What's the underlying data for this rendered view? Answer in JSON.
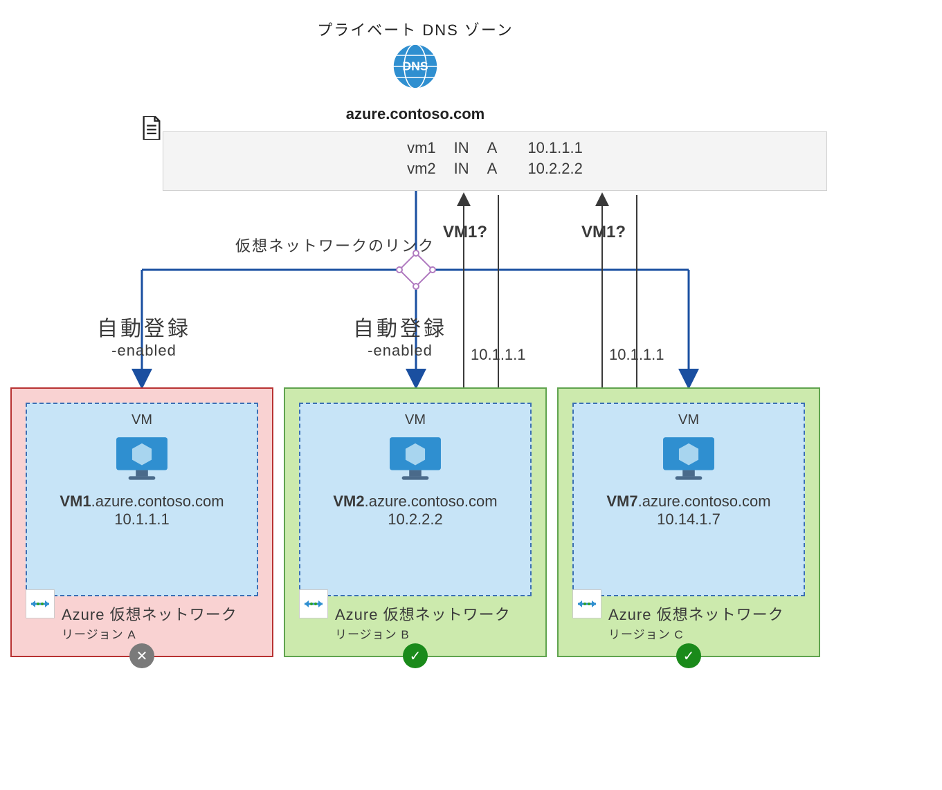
{
  "dns": {
    "title": "プライベート DNS ゾーン",
    "domain": "azure.contoso.com",
    "records": [
      {
        "name": "vm1",
        "class": "IN",
        "type": "A",
        "value": "10.1.1.1"
      },
      {
        "name": "vm2",
        "class": "IN",
        "type": "A",
        "value": "10.2.2.2"
      }
    ]
  },
  "link_label": "仮想ネットワークのリンク",
  "autoreg": {
    "label": "自動登録",
    "enabled": "-enabled"
  },
  "query": {
    "q": "VM1?",
    "a": "10.1.1.1"
  },
  "vm_generic_label": "VM",
  "vnets": {
    "a": {
      "vm_name": "VM1",
      "vm_fqdn_suffix": ".azure.contoso.com",
      "vm_ip": "10.1.1.1",
      "title": "Azure 仮想ネットワーク",
      "region": "リージョン A",
      "status": "fail"
    },
    "b": {
      "vm_name": "VM2",
      "vm_fqdn_suffix": ".azure.contoso.com",
      "vm_ip": "10.2.2.2",
      "title": "Azure 仮想ネットワーク",
      "region": "リージョン B",
      "status": "ok"
    },
    "c": {
      "vm_name": "VM7",
      "vm_fqdn_suffix": ".azure.contoso.com",
      "vm_ip": "10.14.1.7",
      "title": "Azure 仮想ネットワーク",
      "region": "リージョン C",
      "status": "ok"
    }
  }
}
